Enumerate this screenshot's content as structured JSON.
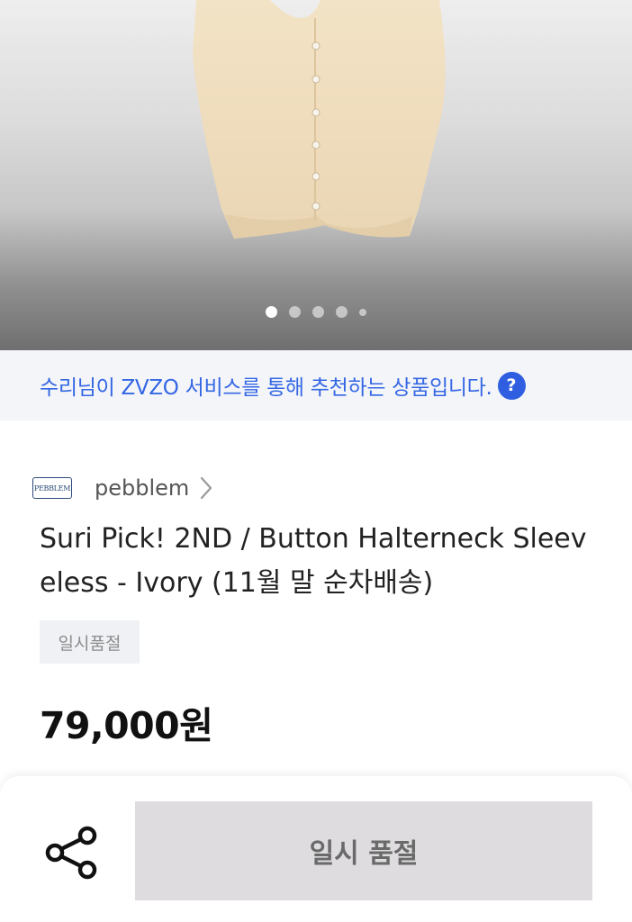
{
  "hero": {
    "image_name": "product-image-ivory-halterneck",
    "carousel": {
      "total": 5,
      "active_index": 0
    }
  },
  "recommendation": {
    "text": "수리님이 ZVZO 서비스를 통해 추천하는 상품입니다.",
    "help_glyph": "?"
  },
  "brand": {
    "logo_text": "PEBBLEM",
    "name": "pebblem"
  },
  "product": {
    "title": "Suri Pick! 2ND / Button Halterneck Sleeveless - Ivory (11월 말 순차배송)",
    "badge": "일시품절",
    "price": "79,000원"
  },
  "bottom_bar": {
    "buy_button_label": "일시 품절",
    "share_icon": "share-icon"
  },
  "colors": {
    "accent": "#3467e4",
    "reco_bg": "#f3f5f9",
    "soldout_bg": "#dedcdf"
  }
}
